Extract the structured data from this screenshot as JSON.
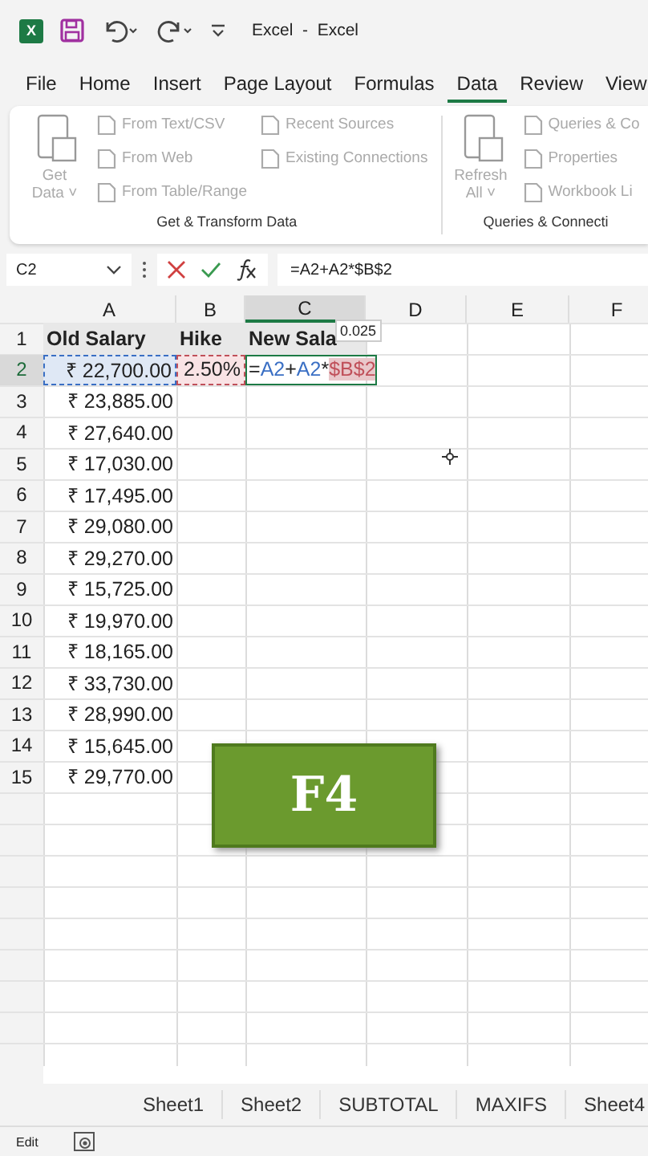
{
  "title_bar": {
    "logo_letter": "X",
    "title": "Excel  -  Excel"
  },
  "menu_tabs": [
    {
      "label": "File",
      "selected": false
    },
    {
      "label": "Home",
      "selected": false
    },
    {
      "label": "Insert",
      "selected": false
    },
    {
      "label": "Page Layout",
      "selected": false
    },
    {
      "label": "Formulas",
      "selected": false
    },
    {
      "label": "Data",
      "selected": true
    },
    {
      "label": "Review",
      "selected": false
    },
    {
      "label": "View",
      "selected": false
    }
  ],
  "ribbon": {
    "groups": [
      {
        "title": "Get & Transform Data",
        "big": {
          "label_lines": [
            "Get",
            "Data ˅"
          ],
          "disabled": true
        },
        "columns": [
          [
            "From Text/CSV",
            "From Web",
            "From Table/Range"
          ],
          [
            "Recent Sources",
            "Existing Connections"
          ]
        ]
      },
      {
        "title": "Queries & Connecti",
        "big": {
          "label_lines": [
            "Refresh",
            "All ˅"
          ],
          "disabled": true
        },
        "columns": [
          [
            "Queries & Co",
            "Properties",
            "Workbook Li"
          ]
        ]
      }
    ]
  },
  "formula_bar": {
    "name_box": "C2",
    "formula": "=A2+A2*$B$2"
  },
  "columns": [
    {
      "label": "A",
      "selected": false
    },
    {
      "label": "B",
      "selected": false
    },
    {
      "label": "C",
      "selected": true
    },
    {
      "label": "D",
      "selected": false
    },
    {
      "label": "E",
      "selected": false
    },
    {
      "label": "F",
      "selected": false
    }
  ],
  "rows": [
    {
      "num": "1",
      "cells": [
        "Old Salary",
        "Hike",
        "New Sala"
      ]
    },
    {
      "num": "2",
      "cells": [
        "₹ 22,700.00",
        "2.50%",
        ""
      ]
    },
    {
      "num": "3",
      "cells": [
        "₹ 23,885.00"
      ]
    },
    {
      "num": "4",
      "cells": [
        "₹ 27,640.00"
      ]
    },
    {
      "num": "5",
      "cells": [
        "₹ 17,030.00"
      ]
    },
    {
      "num": "6",
      "cells": [
        "₹ 17,495.00"
      ]
    },
    {
      "num": "7",
      "cells": [
        "₹ 29,080.00"
      ]
    },
    {
      "num": "8",
      "cells": [
        "₹ 29,270.00"
      ]
    },
    {
      "num": "9",
      "cells": [
        "₹ 15,725.00"
      ]
    },
    {
      "num": "10",
      "cells": [
        "₹ 19,970.00"
      ]
    },
    {
      "num": "11",
      "cells": [
        "₹ 18,165.00"
      ]
    },
    {
      "num": "12",
      "cells": [
        "₹ 33,730.00"
      ]
    },
    {
      "num": "13",
      "cells": [
        "₹ 28,990.00"
      ]
    },
    {
      "num": "14",
      "cells": [
        "₹ 15,645.00"
      ]
    },
    {
      "num": "15",
      "cells": [
        "₹ 29,770.00"
      ]
    }
  ],
  "editing_cell": {
    "segments": [
      {
        "text": "=",
        "color": "#222222"
      },
      {
        "text": "A2",
        "color": "#3a6fc4"
      },
      {
        "text": "+",
        "color": "#222222"
      },
      {
        "text": "A2",
        "color": "#3a6fc4"
      },
      {
        "text": "*",
        "color": "#222222"
      },
      {
        "text": "$B$2",
        "color": "#c0505a"
      }
    ]
  },
  "tooltip": "0.025",
  "key_overlay": "F4",
  "sheet_tabs": [
    {
      "label": "Sheet1",
      "selected": false
    },
    {
      "label": "Sheet2",
      "selected": false
    },
    {
      "label": "SUBTOTAL",
      "selected": false
    },
    {
      "label": "MAXIFS",
      "selected": false
    },
    {
      "label": "Sheet4",
      "selected": false
    }
  ],
  "status": "Edit"
}
